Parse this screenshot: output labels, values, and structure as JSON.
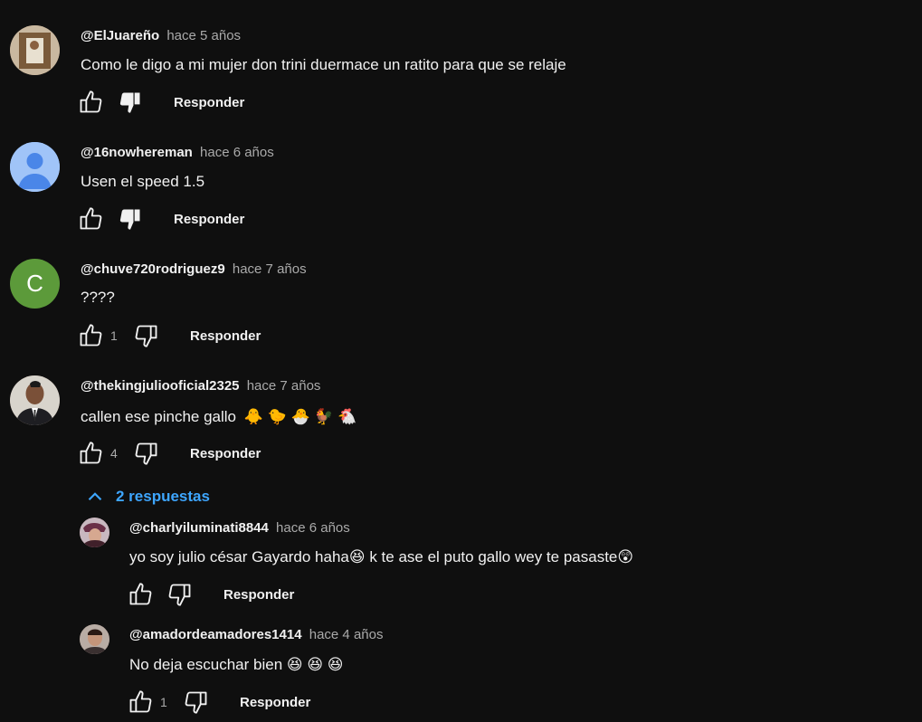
{
  "comments": [
    {
      "author": "@ElJuareño",
      "time": "hace 5 años",
      "text": "Como le digo a mi mujer don trini  duermace un ratito para que se relaje",
      "likes": "",
      "reply_label": "Responder",
      "avatar_color": "#8a6a4a"
    },
    {
      "author": "@16nowhereman",
      "time": "hace 6 años",
      "text": "Usen el speed 1.5",
      "likes": "",
      "reply_label": "Responder",
      "avatar_color": "#7fb0f5"
    },
    {
      "author": "@chuve720rodriguez9",
      "time": "hace 7 años",
      "text": "????",
      "likes": "1",
      "reply_label": "Responder",
      "avatar_letter": "C",
      "avatar_color": "#5c9a3a"
    },
    {
      "author": "@thekingjuliooficial2325",
      "time": "hace 7 años",
      "text": "callen ese pinche gallo",
      "emojis": "🐥 🐤 🐣 🐓 🐔",
      "likes": "4",
      "reply_label": "Responder",
      "avatar_color": "#6b4a3a"
    }
  ],
  "replies_toggle": "2 respuestas",
  "replies": [
    {
      "author": "@charlyiluminati8844",
      "time": "hace 6 años",
      "text": "yo soy julio césar Gayardo haha",
      "emoji1": "😆",
      "text2": " k te ase el puto gallo wey te pasaste",
      "emoji2": "😲",
      "likes": "",
      "reply_label": "Responder",
      "avatar_color": "#7a4a5a"
    },
    {
      "author": "@amadordeamadores1414",
      "time": "hace 4 años",
      "text": "No deja escuchar bien",
      "emojis": "😆 😆 😆",
      "likes": "1",
      "reply_label": "Responder",
      "avatar_color": "#6a5048"
    }
  ]
}
